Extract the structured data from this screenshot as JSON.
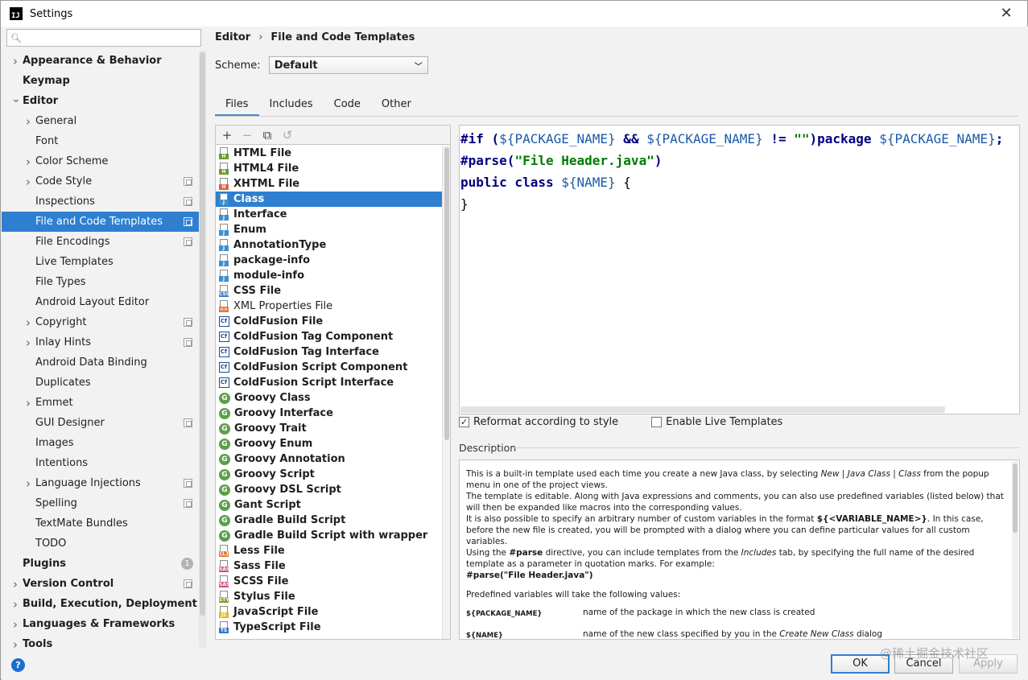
{
  "window": {
    "title": "Settings"
  },
  "search": {
    "placeholder": ""
  },
  "sidebar": {
    "items": [
      {
        "label": "Appearance & Behavior",
        "level": 0,
        "bold": true,
        "arrow": "right",
        "proj": false
      },
      {
        "label": "Keymap",
        "level": 0,
        "bold": true,
        "arrow": "",
        "proj": false
      },
      {
        "label": "Editor",
        "level": 0,
        "bold": true,
        "arrow": "down",
        "proj": false
      },
      {
        "label": "General",
        "level": 1,
        "arrow": "right",
        "proj": false
      },
      {
        "label": "Font",
        "level": 1,
        "arrow": "",
        "proj": false
      },
      {
        "label": "Color Scheme",
        "level": 1,
        "arrow": "right",
        "proj": false
      },
      {
        "label": "Code Style",
        "level": 1,
        "arrow": "right",
        "proj": true
      },
      {
        "label": "Inspections",
        "level": 1,
        "arrow": "",
        "proj": true
      },
      {
        "label": "File and Code Templates",
        "level": 1,
        "arrow": "",
        "proj": true,
        "selected": true
      },
      {
        "label": "File Encodings",
        "level": 1,
        "arrow": "",
        "proj": true
      },
      {
        "label": "Live Templates",
        "level": 1,
        "arrow": "",
        "proj": false
      },
      {
        "label": "File Types",
        "level": 1,
        "arrow": "",
        "proj": false
      },
      {
        "label": "Android Layout Editor",
        "level": 1,
        "arrow": "",
        "proj": false
      },
      {
        "label": "Copyright",
        "level": 1,
        "arrow": "right",
        "proj": true
      },
      {
        "label": "Inlay Hints",
        "level": 1,
        "arrow": "right",
        "proj": true
      },
      {
        "label": "Android Data Binding",
        "level": 1,
        "arrow": "",
        "proj": false
      },
      {
        "label": "Duplicates",
        "level": 1,
        "arrow": "",
        "proj": false
      },
      {
        "label": "Emmet",
        "level": 1,
        "arrow": "right",
        "proj": false
      },
      {
        "label": "GUI Designer",
        "level": 1,
        "arrow": "",
        "proj": true
      },
      {
        "label": "Images",
        "level": 1,
        "arrow": "",
        "proj": false
      },
      {
        "label": "Intentions",
        "level": 1,
        "arrow": "",
        "proj": false
      },
      {
        "label": "Language Injections",
        "level": 1,
        "arrow": "right",
        "proj": true
      },
      {
        "label": "Spelling",
        "level": 1,
        "arrow": "",
        "proj": true
      },
      {
        "label": "TextMate Bundles",
        "level": 1,
        "arrow": "",
        "proj": false
      },
      {
        "label": "TODO",
        "level": 1,
        "arrow": "",
        "proj": false
      },
      {
        "label": "Plugins",
        "level": 0,
        "bold": true,
        "arrow": "",
        "proj": false,
        "badge": "1"
      },
      {
        "label": "Version Control",
        "level": 0,
        "bold": true,
        "arrow": "right",
        "proj": true
      },
      {
        "label": "Build, Execution, Deployment",
        "level": 0,
        "bold": true,
        "arrow": "right",
        "proj": false
      },
      {
        "label": "Languages & Frameworks",
        "level": 0,
        "bold": true,
        "arrow": "right",
        "proj": false
      },
      {
        "label": "Tools",
        "level": 0,
        "bold": true,
        "arrow": "right",
        "proj": false
      }
    ]
  },
  "breadcrumb": {
    "parent": "Editor",
    "separator": "›",
    "current": "File and Code Templates"
  },
  "scheme": {
    "label": "Scheme:",
    "value": "Default"
  },
  "tabs": [
    {
      "label": "Files",
      "active": true
    },
    {
      "label": "Includes",
      "active": false
    },
    {
      "label": "Code",
      "active": false
    },
    {
      "label": "Other",
      "active": false
    }
  ],
  "templates": [
    {
      "label": "HTML File",
      "icon": "html",
      "tag": "H",
      "color": "#6f9b2d"
    },
    {
      "label": "HTML4 File",
      "icon": "html",
      "tag": "H",
      "color": "#6f9b2d"
    },
    {
      "label": "XHTML File",
      "icon": "html",
      "tag": "H",
      "color": "#e0623d"
    },
    {
      "label": "Class",
      "icon": "java",
      "tag": "J",
      "color": "#3f8fd0",
      "selected": true
    },
    {
      "label": "Interface",
      "icon": "java",
      "tag": "J",
      "color": "#3f8fd0"
    },
    {
      "label": "Enum",
      "icon": "java",
      "tag": "J",
      "color": "#3f8fd0"
    },
    {
      "label": "AnnotationType",
      "icon": "java",
      "tag": "J",
      "color": "#3f8fd0"
    },
    {
      "label": "package-info",
      "icon": "java",
      "tag": "J",
      "color": "#3f8fd0"
    },
    {
      "label": "module-info",
      "icon": "java",
      "tag": "J",
      "color": "#3f8fd0"
    },
    {
      "label": "CSS File",
      "icon": "css",
      "tag": "CSS",
      "color": "#3a7ec7"
    },
    {
      "label": "XML Properties File",
      "icon": "xml",
      "tag": "<>",
      "color": "#e07b39",
      "normal": true
    },
    {
      "label": "ColdFusion File",
      "icon": "cf"
    },
    {
      "label": "ColdFusion Tag Component",
      "icon": "cf"
    },
    {
      "label": "ColdFusion Tag Interface",
      "icon": "cf"
    },
    {
      "label": "ColdFusion Script Component",
      "icon": "cf"
    },
    {
      "label": "ColdFusion Script Interface",
      "icon": "cf"
    },
    {
      "label": "Groovy Class",
      "icon": "groovy"
    },
    {
      "label": "Groovy Interface",
      "icon": "groovy"
    },
    {
      "label": "Groovy Trait",
      "icon": "groovy"
    },
    {
      "label": "Groovy Enum",
      "icon": "groovy"
    },
    {
      "label": "Groovy Annotation",
      "icon": "groovy"
    },
    {
      "label": "Groovy Script",
      "icon": "groovy"
    },
    {
      "label": "Groovy DSL Script",
      "icon": "groovy"
    },
    {
      "label": "Gant Script",
      "icon": "groovy"
    },
    {
      "label": "Gradle Build Script",
      "icon": "groovy"
    },
    {
      "label": "Gradle Build Script with wrapper",
      "icon": "groovy"
    },
    {
      "label": "Less File",
      "icon": "less",
      "tag": "{L}",
      "color": "#e07b39"
    },
    {
      "label": "Sass File",
      "icon": "sass",
      "tag": "SASS",
      "color": "#c6538c"
    },
    {
      "label": "SCSS File",
      "icon": "sass",
      "tag": "SASS",
      "color": "#c6538c"
    },
    {
      "label": "Stylus File",
      "icon": "styl",
      "tag": "STYL",
      "color": "#8a9a2a"
    },
    {
      "label": "JavaScript File",
      "icon": "js",
      "tag": "JS",
      "color": "#e3b81c"
    },
    {
      "label": "TypeScript File",
      "icon": "ts",
      "tag": "TS",
      "color": "#3178c6"
    }
  ],
  "editor": {
    "lines": [
      [
        {
          "t": "#if (",
          "c": "kw"
        },
        {
          "t": "${PACKAGE_NAME}",
          "c": "var"
        },
        {
          "t": " && ",
          "c": "kw"
        },
        {
          "t": "${PACKAGE_NAME}",
          "c": "var"
        },
        {
          "t": " != ",
          "c": "kw"
        },
        {
          "t": "\"\"",
          "c": "str"
        },
        {
          "t": ")package ",
          "c": "kw"
        },
        {
          "t": "${PACKAGE_NAME}",
          "c": "var"
        },
        {
          "t": ";",
          "c": "kw"
        }
      ],
      [
        {
          "t": "#parse(",
          "c": "kw"
        },
        {
          "t": "\"File Header.java\"",
          "c": "str"
        },
        {
          "t": ")",
          "c": "kw"
        }
      ],
      [
        {
          "t": "public class ",
          "c": "kw"
        },
        {
          "t": "${NAME}",
          "c": "var"
        },
        {
          "t": " {",
          "c": "plain"
        }
      ],
      [
        {
          "t": "}",
          "c": "plain"
        }
      ]
    ]
  },
  "options": {
    "reformat": {
      "label": "Reformat according to style",
      "checked": true
    },
    "live_templates": {
      "label": "Enable Live Templates",
      "checked": false
    }
  },
  "description": {
    "label": "Description",
    "p1_a": "This is a built-in template used each time you create a new Java class, by selecting ",
    "p1_new": "New",
    "p1_sep1": " | ",
    "p1_jc": "Java Class",
    "p1_sep2": " | ",
    "p1_class": "Class",
    "p1_b": " from the popup menu in one of the project views.",
    "p2": "The template is editable. Along with Java expressions and comments, you can also use predefined variables (listed below) that will then be expanded like macros into the corresponding values.",
    "p3_a": "It is also possible to specify an arbitrary number of custom variables in the format ",
    "p3_fmt": "${<VARIABLE_NAME>}",
    "p3_b": ". In this case, before the new file is created, you will be prompted with a dialog where you can define particular values for all custom variables.",
    "p4_a": "Using the ",
    "p4_parse": "#parse",
    "p4_b": " directive, you can include templates from the ",
    "p4_inc": "Includes",
    "p4_c": " tab, by specifying the full name of the desired template as a parameter in quotation marks. For example:",
    "p4_example": "#parse(\"File Header.java\")",
    "p5": "Predefined variables will take the following values:",
    "vars": [
      {
        "name": "${PACKAGE_NAME}",
        "desc": "name of the package in which the new class is created"
      },
      {
        "name": "${NAME}",
        "desc_a": "name of the new class specified by you in the ",
        "desc_i": "Create New Class",
        "desc_b": " dialog"
      }
    ]
  },
  "buttons": {
    "help": "?",
    "ok": "OK",
    "cancel": "Cancel",
    "apply": "Apply"
  },
  "watermark": "@稀土掘金技术社区"
}
